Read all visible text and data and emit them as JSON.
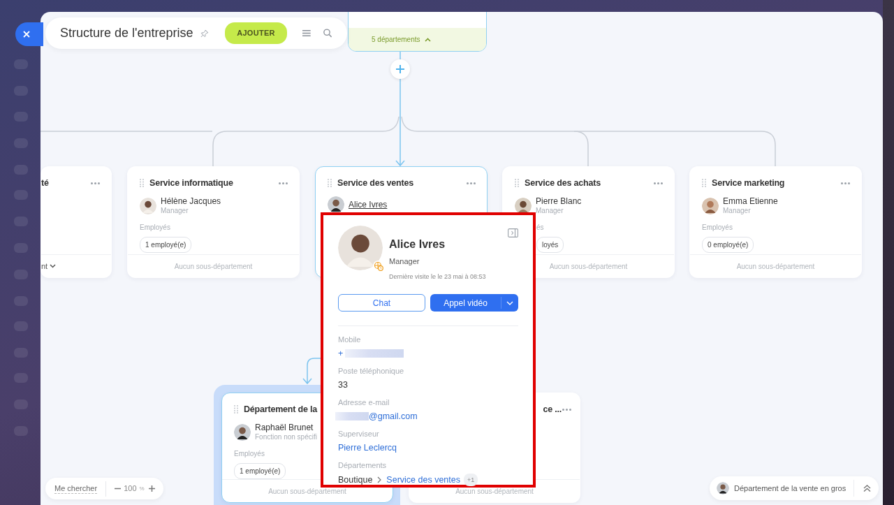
{
  "header": {
    "title": "Structure de l'entreprise",
    "add_button": "AJOUTER"
  },
  "top_node": {
    "subdepartments": "5 départements",
    "expanded": true
  },
  "departments": [
    {
      "kind": "cut",
      "title": "té",
      "selected": false,
      "footer": "nt"
    },
    {
      "kind": "full",
      "title": "Service informatique",
      "selected": false,
      "head": {
        "name": "Hélène Jacques",
        "role": "Manager"
      },
      "employees_label": "Employés",
      "employees": "1 employé(e)",
      "footer": "Aucun sous-département"
    },
    {
      "kind": "full",
      "title": "Service des ventes",
      "selected": true,
      "head": {
        "name": "Alice Ivres"
      }
    },
    {
      "kind": "left-covered",
      "title": "Service des achats",
      "selected": false,
      "head": {
        "name": "Pierre Blanc",
        "role": "Manager"
      },
      "employees_label": "és",
      "employees": "loyés",
      "footer": "Aucun sous-département"
    },
    {
      "kind": "full",
      "title": "Service marketing",
      "selected": false,
      "head": {
        "name": "Emma Etienne",
        "role": "Manager"
      },
      "employees_label": "Employés",
      "employees": "0 employé(e)",
      "footer": "Aucun sous-département"
    }
  ],
  "sub_departments": [
    {
      "kind": "full",
      "title": "Département de la",
      "selected": true,
      "highlighted": true,
      "head": {
        "name": "Raphaël Brunet",
        "role": "Fonction non spécifi"
      },
      "employees_label": "Employés",
      "employees": "1 employé(e)",
      "footer": "Aucun sous-département"
    },
    {
      "kind": "right-part",
      "title": "ce ...",
      "selected": false,
      "highlighted": false,
      "footer": "Aucun sous-département"
    }
  ],
  "profile_card": {
    "name": "Alice Ivres",
    "role": "Manager",
    "last_seen": "Dernière visite le le 23 mai à 08:53",
    "chat_button": "Chat",
    "call_button": "Appel vidéo",
    "fields": [
      {
        "kind": "phone",
        "label": "Mobile",
        "value": "+"
      },
      {
        "kind": "text",
        "label": "Poste téléphonique",
        "value": "33"
      },
      {
        "kind": "email",
        "label": "Adresse e-mail",
        "value": "@gmail.com"
      },
      {
        "kind": "link",
        "label": "Superviseur",
        "value": "Pierre Leclercq"
      },
      {
        "kind": "path",
        "label": "Départements",
        "parent": "Boutique",
        "value": "Service des ventes",
        "extra": "+1"
      }
    ]
  },
  "locate_button": "Me chercher",
  "zoom": {
    "value": "100",
    "unit": "%"
  },
  "current_department": {
    "name": "Département de la vente en gros"
  }
}
